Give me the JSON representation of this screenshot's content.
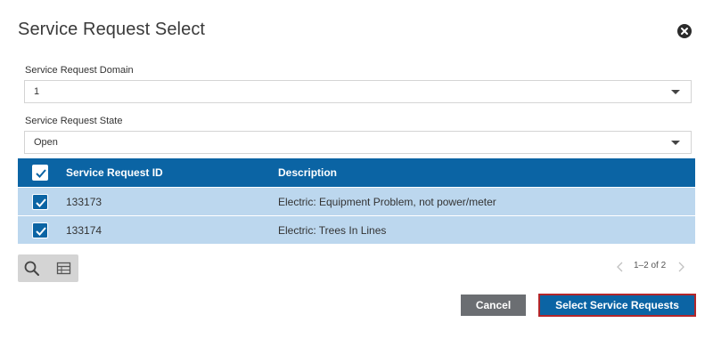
{
  "dialog": {
    "title": "Service Request Select"
  },
  "fields": {
    "domain": {
      "label": "Service Request Domain",
      "value": "1"
    },
    "state": {
      "label": "Service Request State",
      "value": "Open"
    }
  },
  "grid": {
    "columns": {
      "id": "Service Request ID",
      "description": "Description"
    },
    "rows": [
      {
        "id": "133173",
        "description": "Electric: Equipment Problem, not power/meter",
        "checked": true
      },
      {
        "id": "133174",
        "description": "Electric: Trees In Lines",
        "checked": true
      }
    ]
  },
  "pager": {
    "text": "1–2 of 2"
  },
  "buttons": {
    "cancel": "Cancel",
    "select": "Select Service Requests"
  },
  "colors": {
    "header_blue": "#0b64a4",
    "row_selected": "#bcd7ee",
    "cancel_gray": "#6b6e72",
    "focus_red": "#b3262a"
  }
}
